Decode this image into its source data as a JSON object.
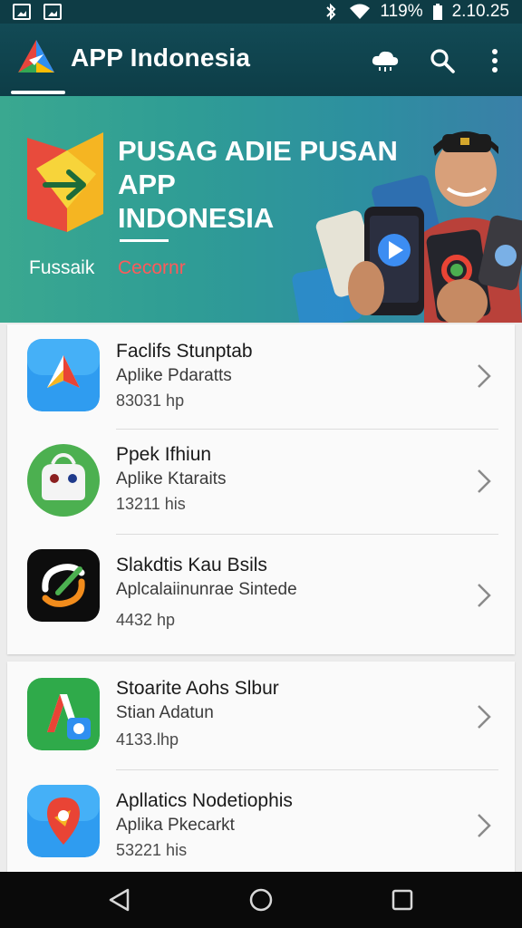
{
  "status_bar": {
    "battery": "119%",
    "time": "2.10.25",
    "icons": [
      "gallery-icon",
      "image-icon",
      "bluetooth-icon",
      "wifi-icon",
      "signal-icon",
      "battery-icon"
    ]
  },
  "app_bar": {
    "title": "APP Indonesia",
    "actions": [
      "cloud-icon",
      "search-icon",
      "more-vert-icon"
    ]
  },
  "banner": {
    "title_line1": "PUSAG ADIE PUSAN",
    "title_line2": "APP",
    "title_line3": "INDONESIA",
    "left_label": "Fussaik",
    "right_label": "Cecornr"
  },
  "apps": [
    {
      "name": "Faclifs Stunptab",
      "subtitle": "Aplike Pdaratts",
      "size": "83031 hp"
    },
    {
      "name": "Ppek Ifhiun",
      "subtitle": "Aplike Ktaraits",
      "size": "13211 his"
    },
    {
      "name": "Slakdtis Kau Bsils",
      "subtitle": "Aplcalaiinunrae Sintede",
      "size": "4432 hp"
    },
    {
      "name": "Stoarite Aohs Slbur",
      "subtitle": "Stian Adatun",
      "size": "4133.lhp"
    },
    {
      "name": "Apllatics Nodetiophis",
      "subtitle": "Aplika Pkecarkt",
      "size": "53221 his"
    }
  ],
  "colors": {
    "app_bar": "#124a55",
    "banner_start": "#3aa890",
    "banner_end": "#3a7fa8",
    "accent_red": "#ff5a5a"
  },
  "nav": [
    "back-icon",
    "home-icon",
    "recents-icon"
  ]
}
